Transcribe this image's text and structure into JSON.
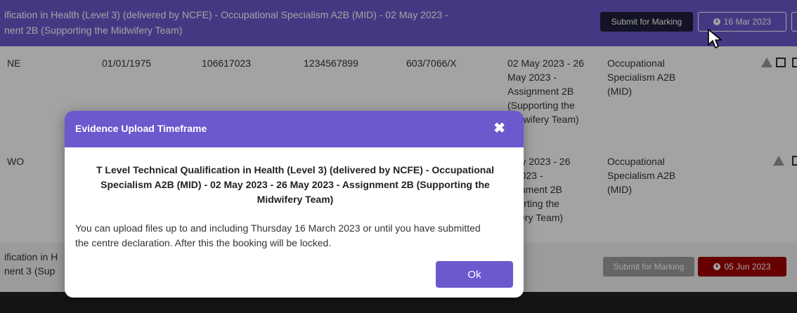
{
  "header": {
    "title_line1": "ification in Health (Level 3) (delivered by NCFE) - Occupational Specialism A2B (MID) - 02 May 2023 -",
    "title_line2": "nent 2B (Supporting the Midwifery Team)",
    "submit_label": "Submit for Marking",
    "date_label": "16 Mar 2023"
  },
  "rows": [
    {
      "name": "NE",
      "dob": "01/01/1975",
      "id1": "106617023",
      "id2": "1234567899",
      "code": "603/7066/X",
      "window": [
        "02 May 2023 - 26",
        "May 2023 -",
        "Assignment 2B",
        "(Supporting the",
        "Midwifery Team)"
      ],
      "specialism": [
        "Occupational",
        "Specialism A2B",
        "(MID)"
      ]
    },
    {
      "name": "WO",
      "window": [
        "May 2023 - 26",
        "y 2023 -",
        "signment 2B",
        "pporting the",
        "wifery Team)"
      ],
      "specialism": [
        "Occupational",
        "Specialism A2B",
        "(MID)"
      ]
    }
  ],
  "row3": {
    "title_line1": "ification in H",
    "title_line2": "nent 3 (Sup",
    "submit_label": "Submit for Marking",
    "date_label": "05 Jun 2023"
  },
  "modal": {
    "title": "Evidence Upload Timeframe",
    "close_glyph": "✖",
    "qualification": "T Level Technical Qualification in Health (Level 3) (delivered by NCFE) - Occupational Specialism A2B (MID) - 02 May 2023 - 26 May 2023 - Assignment 2B (Supporting the Midwifery Team)",
    "message": "You can upload files up to and including Thursday 16 March 2023 or until you have submitted the centre declaration. After this the booking will be locked.",
    "ok_label": "Ok"
  },
  "colors": {
    "accent": "#6a5acd",
    "danger": "#a10000",
    "dark_button": "#1f1f3a"
  },
  "icons": [
    "clock-icon",
    "warning-icon",
    "edit-icon",
    "close-icon",
    "cursor-icon"
  ]
}
